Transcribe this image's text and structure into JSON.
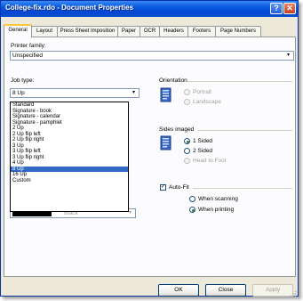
{
  "window": {
    "title": "College-fix.rdo - Document Properties",
    "help_glyph": "?",
    "close_glyph": "✕"
  },
  "tabs": [
    {
      "label": "General",
      "active": true
    },
    {
      "label": "Layout"
    },
    {
      "label": "Press Sheet Imposition"
    },
    {
      "label": "Paper"
    },
    {
      "label": "OCR"
    },
    {
      "label": "Headers"
    },
    {
      "label": "Footers"
    },
    {
      "label": "Page Numbers"
    }
  ],
  "printer_family": {
    "label": "Printer family:",
    "value": "Unspecified",
    "arrow": "▾"
  },
  "job_type": {
    "label": "Job type:",
    "value": "8 Up",
    "arrow": "▾",
    "options": [
      "Standard",
      "Signature - book",
      "Signature - calendar",
      "Signature - pamphlet",
      "2 Up",
      "2 Up flip left",
      "2 Up flip right",
      "3 Up",
      "3 Up flip left",
      "3 Up flip right",
      "4 Up",
      "8 Up",
      "16 Up",
      "Custom"
    ],
    "selected": "8 Up"
  },
  "behind_list_combo": {
    "value": "Black",
    "arrow": "▾",
    "swatch_color": "#000000"
  },
  "orientation": {
    "label": "Orientation",
    "options": [
      "Portrait",
      "Landscape"
    ],
    "disabled": true
  },
  "sides_imaged": {
    "label": "Sides imaged",
    "options": [
      {
        "label": "1 Sided",
        "checked": true
      },
      {
        "label": "2 Sided",
        "checked": false
      },
      {
        "label": "Head to Foot",
        "checked": false,
        "disabled": true
      }
    ]
  },
  "auto_fit": {
    "label": "Auto-Fit",
    "checked": true,
    "check_glyph": "✓",
    "options": [
      {
        "label": "When scanning",
        "checked": false
      },
      {
        "label": "When printing",
        "checked": true
      }
    ]
  },
  "buttons": {
    "ok": "OK",
    "close": "Close",
    "apply": "Apply"
  },
  "colors": {
    "titlebar": "#0a5ce0",
    "selection": "#316ac5",
    "dialog_bg": "#ece9d8",
    "active_tab_accent": "#ffc73c"
  }
}
